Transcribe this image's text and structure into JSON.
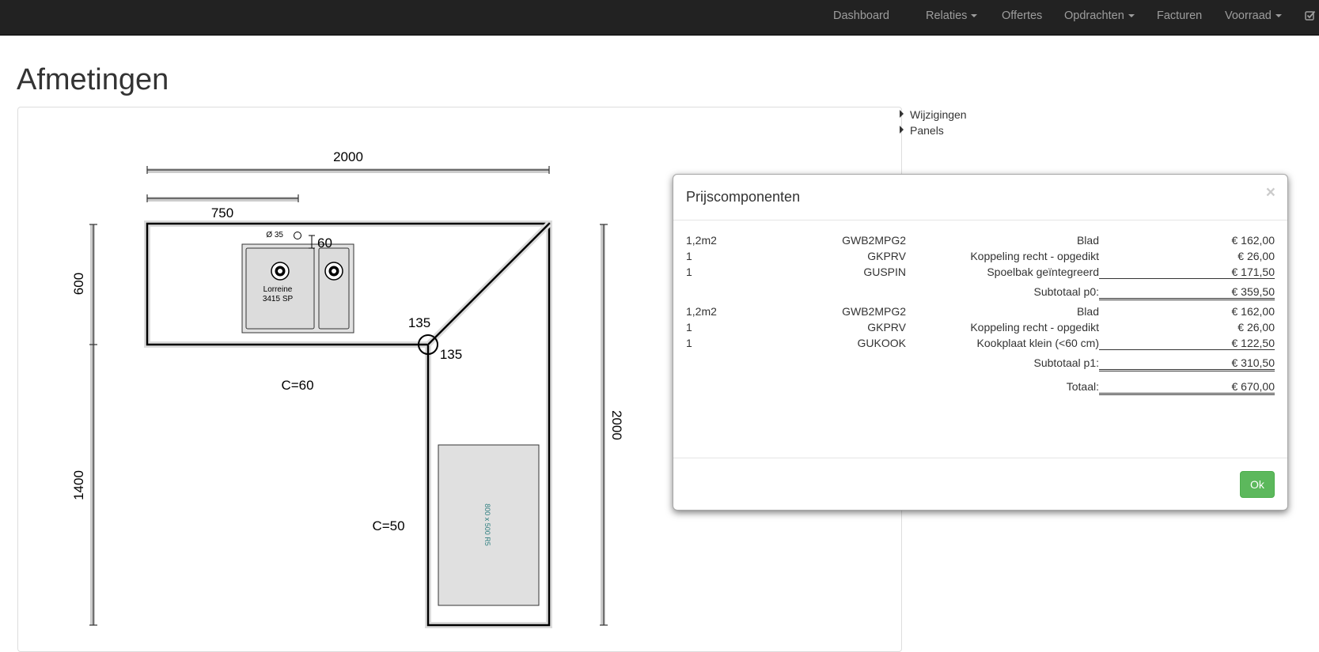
{
  "nav": {
    "items": [
      {
        "label": "Dashboard"
      },
      {
        "label": "Relaties",
        "dropdown": true
      },
      {
        "label": "Offertes"
      },
      {
        "label": "Opdrachten",
        "dropdown": true
      },
      {
        "label": "Facturen"
      },
      {
        "label": "Voorraad",
        "dropdown": true
      }
    ],
    "check_icon": "check-square-icon"
  },
  "page": {
    "title": "Afmetingen"
  },
  "side_toggles": [
    {
      "label": "Wijzigingen"
    },
    {
      "label": "Panels"
    }
  ],
  "drawing": {
    "dim_top_width": "2000",
    "dim_sink_offset": "750",
    "dim_left_upper": "600",
    "dim_left_lower": "1400",
    "dim_right_height": "2000",
    "hole_diameter": "Ø 35",
    "sink_edge_distance": "60",
    "sink_name": "Lorreine",
    "sink_model": "3415 SP",
    "corner_angle_1": "135",
    "corner_angle_2": "135",
    "clearance_upper": "C=60",
    "clearance_lower": "C=50",
    "cooktop_label": "800 x 500 R5"
  },
  "modal": {
    "title": "Prijscomponenten",
    "close_symbol": "×",
    "rows": [
      {
        "qty": "1,2m2",
        "code": "GWB2MPG2",
        "desc": "Blad",
        "amount": "€ 162,00"
      },
      {
        "qty": "1",
        "code": "GKPRV",
        "desc": "Koppeling recht - opgedikt",
        "amount": "€ 26,00"
      },
      {
        "qty": "1",
        "code": "GUSPIN",
        "desc": "Spoelbak geïntegreerd",
        "amount": "€ 171,50"
      }
    ],
    "subtotal_p0": {
      "label": "Subtotaal p0:",
      "amount": "€ 359,50"
    },
    "rows_p1": [
      {
        "qty": "1,2m2",
        "code": "GWB2MPG2",
        "desc": "Blad",
        "amount": "€ 162,00"
      },
      {
        "qty": "1",
        "code": "GKPRV",
        "desc": "Koppeling recht - opgedikt",
        "amount": "€ 26,00"
      },
      {
        "qty": "1",
        "code": "GUKOOK",
        "desc": "Kookplaat klein (<60 cm)",
        "amount": "€ 122,50"
      }
    ],
    "subtotal_p1": {
      "label": "Subtotaal p1:",
      "amount": "€ 310,50"
    },
    "total": {
      "label": "Totaal:",
      "amount": "€ 670,00"
    },
    "ok_label": "Ok"
  }
}
